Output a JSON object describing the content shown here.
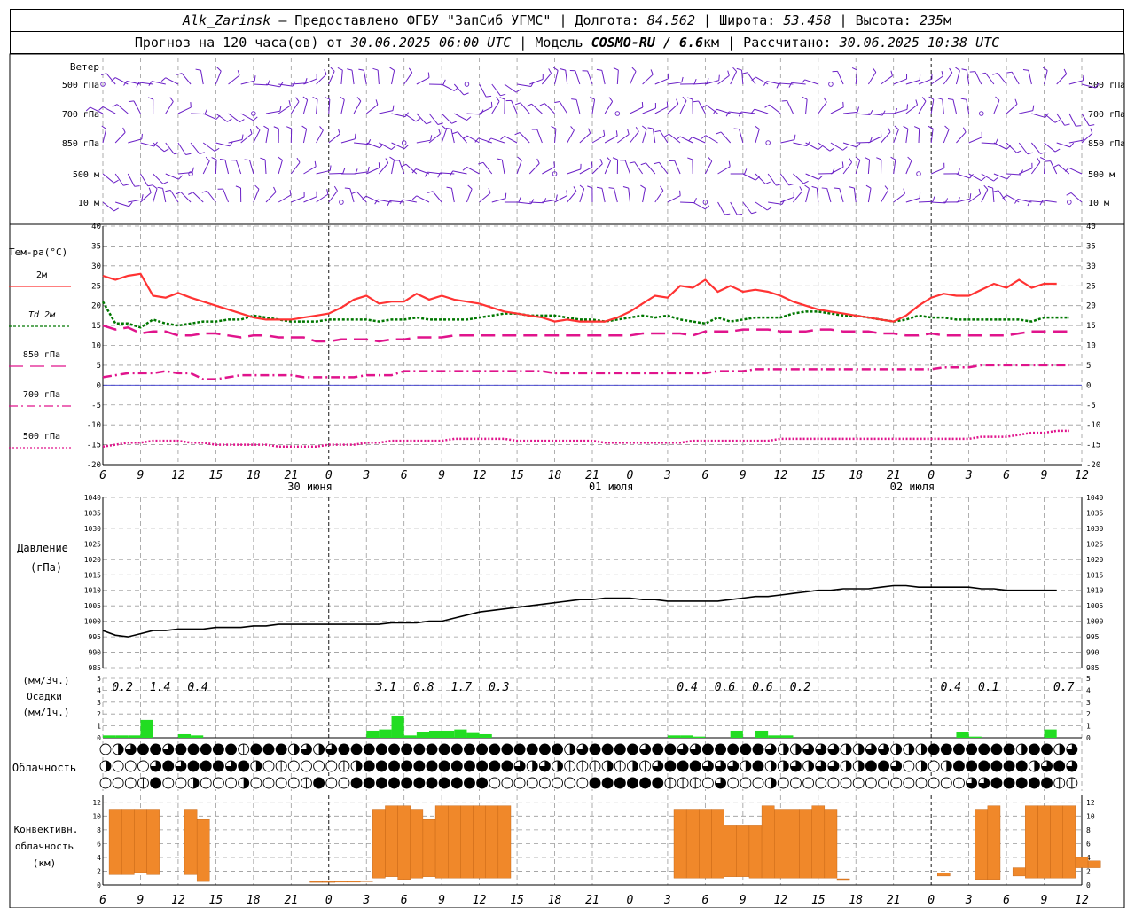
{
  "header": {
    "station": "Alk_Zarinsk",
    "provider": " – Предоставлено ФГБУ \"ЗапСиб УГМС\" | Долгота: ",
    "lon": "84.562",
    "lat_label": " | Широта: ",
    "lat": "53.458",
    "alt_label": " | Высота: ",
    "alt": "235",
    "alt_unit": "м",
    "fc_label": "Прогноз на 120 часа(ов) от ",
    "fc_time": "30.06.2025 06:00 UTC",
    "model_label": " | Модель ",
    "model": "COSMO-RU / 6.6",
    "model_unit": "км",
    "calc_label": " | Рассчитано: ",
    "calc_time": "30.06.2025 10:38 UTC"
  },
  "labels": {
    "wind_title": "Ветер",
    "wind_levels": [
      "500 гПа",
      "700 гПа",
      "850 гПа",
      "500 м",
      "10 м"
    ],
    "temp_title": "Тем-ра(°C)",
    "legend": [
      {
        "label": "2м",
        "color": "#ff3333",
        "dash": ""
      },
      {
        "label": "Td 2м",
        "color": "#007700",
        "dash": "3,2"
      },
      {
        "label": "850 гПа",
        "color": "#e0148c",
        "dash": "16,8"
      },
      {
        "label": "700 гПа",
        "color": "#e0148c",
        "dash": "10,4,2,4"
      },
      {
        "label": "500 гПа",
        "color": "#e0148c",
        "dash": "2,2"
      }
    ],
    "pressure_title": "Давление",
    "pressure_unit": "(гПа)",
    "precip_unit3": "(мм/3ч.)",
    "precip_title": "Осадки",
    "precip_unit1": "(мм/1ч.)",
    "cloud_title": "Облачность",
    "conv_title1": "Конвективн.",
    "conv_title2": "облачность",
    "conv_unit": "(км)",
    "dates": [
      "30 июня",
      "01 июля",
      "02 июля"
    ]
  },
  "chart_data": {
    "type": "meteogram",
    "x_ticks": [
      "6",
      "9",
      "12",
      "15",
      "18",
      "21",
      "0",
      "3",
      "6",
      "9",
      "12",
      "15",
      "18",
      "21",
      "0",
      "3",
      "6",
      "9",
      "12",
      "15",
      "18",
      "21",
      "0",
      "3",
      "6",
      "9",
      "12"
    ],
    "temperature": {
      "ylim": [
        -20,
        40
      ],
      "ticks": [
        "40",
        "35",
        "30",
        "25",
        "20",
        "15",
        "10",
        "5",
        "0",
        "-5",
        "-10",
        "-15",
        "-20"
      ],
      "t2m": [
        27.5,
        26.5,
        27.5,
        28,
        22.5,
        22,
        23.2,
        22,
        21,
        20,
        19,
        18,
        17,
        16.5,
        16.5,
        16.5,
        17,
        17.5,
        18,
        19.5,
        21.5,
        22.5,
        20.5,
        21,
        21,
        23,
        21.5,
        22.5,
        21.5,
        21,
        20.5,
        19.5,
        18.5,
        18,
        17.5,
        17,
        16,
        16.5,
        16,
        16,
        16,
        17,
        18.5,
        20.5,
        22.5,
        22,
        25,
        24.5,
        26.5,
        23.5,
        25,
        23.5,
        24,
        23.5,
        22.5,
        21,
        20,
        19,
        18.5,
        18,
        17.5,
        17,
        16.5,
        16,
        17.5,
        20,
        22,
        23,
        22.5,
        22.5,
        24,
        25.5,
        24.5,
        26.5,
        24.5,
        25.5,
        25.5
      ],
      "td2m": [
        21,
        15.5,
        15.5,
        14.5,
        16.5,
        15.5,
        15,
        15.5,
        16,
        16,
        16.5,
        16.5,
        17.5,
        17,
        16.5,
        16,
        16,
        16,
        16.5,
        16.5,
        16.5,
        16.5,
        16,
        16.5,
        16.5,
        17,
        16.5,
        16.5,
        16.5,
        16.5,
        17,
        17.5,
        18,
        18,
        17.5,
        17.5,
        17.5,
        17,
        16.5,
        16.5,
        16,
        16.5,
        17,
        17.5,
        17,
        17.5,
        16.5,
        16,
        15.5,
        17,
        16,
        16.5,
        17,
        17,
        17,
        18,
        18.5,
        18.5,
        18,
        17.5,
        17.5,
        17,
        16.5,
        16,
        16.5,
        17.5,
        17,
        17,
        16.5,
        16.5,
        16.5,
        16.5,
        16.5,
        16.5,
        16,
        17,
        17,
        17
      ],
      "t850": [
        15,
        14,
        14.5,
        13,
        13.5,
        13.5,
        12.5,
        12.5,
        13,
        13,
        12.5,
        12,
        12.5,
        12.5,
        12,
        12,
        12,
        11,
        11,
        11.5,
        11.5,
        11.5,
        11,
        11.5,
        11.5,
        12,
        12,
        12,
        12.5,
        12.5,
        12.5,
        12.5,
        12.5,
        12.5,
        12.5,
        12.5,
        12.5,
        12.5,
        12.5,
        12.5,
        12.5,
        12.5,
        12.5,
        13,
        13,
        13,
        13,
        12.5,
        13.5,
        13.5,
        13.5,
        14,
        14,
        14,
        13.5,
        13.5,
        13.5,
        14,
        14,
        13.5,
        13.5,
        13.5,
        13,
        13,
        12.5,
        12.5,
        13,
        12.5,
        12.5,
        12.5,
        12.5,
        12.5,
        12.5,
        13,
        13.5,
        13.5,
        13.5,
        13.5
      ],
      "t700": [
        2,
        2.5,
        3,
        3,
        3,
        3.5,
        3,
        3,
        1.5,
        1.5,
        2,
        2.5,
        2.5,
        2.5,
        2.5,
        2.5,
        2,
        2,
        2,
        2,
        2,
        2.5,
        2.5,
        2.5,
        3.5,
        3.5,
        3.5,
        3.5,
        3.5,
        3.5,
        3.5,
        3.5,
        3.5,
        3.5,
        3.5,
        3.5,
        3,
        3,
        3,
        3,
        3,
        3,
        3,
        3,
        3,
        3,
        3,
        3,
        3,
        3.5,
        3.5,
        3.5,
        4,
        4,
        4,
        4,
        4,
        4,
        4,
        4,
        4,
        4,
        4,
        4,
        4,
        4,
        4,
        4.5,
        4.5,
        4.5,
        5,
        5,
        5,
        5,
        5,
        5,
        5,
        5
      ],
      "t500": [
        -15.5,
        -15,
        -14.5,
        -14.5,
        -14,
        -14,
        -14,
        -14.5,
        -14.5,
        -15,
        -15,
        -15,
        -15,
        -15,
        -15.5,
        -15.5,
        -15.5,
        -15.5,
        -15,
        -15,
        -15,
        -14.5,
        -14.5,
        -14,
        -14,
        -14,
        -14,
        -14,
        -13.5,
        -13.5,
        -13.5,
        -13.5,
        -13.5,
        -14,
        -14,
        -14,
        -14,
        -14,
        -14,
        -14,
        -14.5,
        -14.5,
        -14.5,
        -14.5,
        -14.5,
        -14.5,
        -14.5,
        -14,
        -14,
        -14,
        -14,
        -14,
        -14,
        -14,
        -13.5,
        -13.5,
        -13.5,
        -13.5,
        -13.5,
        -13.5,
        -13.5,
        -13.5,
        -13.5,
        -13.5,
        -13.5,
        -13.5,
        -13.5,
        -13.5,
        -13.5,
        -13.5,
        -13,
        -13,
        -13,
        -12.5,
        -12,
        -12,
        -11.5,
        -11.5
      ]
    },
    "pressure": {
      "ylim": [
        985,
        1040
      ],
      "ticks": [
        "1040",
        "1035",
        "1030",
        "1025",
        "1020",
        "1015",
        "1010",
        "1005",
        "1000",
        "995",
        "990",
        "985"
      ],
      "values": [
        997,
        995.5,
        995,
        996,
        997,
        997,
        997.5,
        997.5,
        997.5,
        998,
        998,
        998,
        998.5,
        998.5,
        999,
        999,
        999,
        999,
        999,
        999,
        999,
        999,
        999,
        999.5,
        999.5,
        999.5,
        1000,
        1000,
        1001,
        1002,
        1003,
        1003.5,
        1004,
        1004.5,
        1005,
        1005.5,
        1006,
        1006.5,
        1007,
        1007,
        1007.5,
        1007.5,
        1007.5,
        1007,
        1007,
        1006.5,
        1006.5,
        1006.5,
        1006.5,
        1006.5,
        1007,
        1007.5,
        1008,
        1008,
        1008.5,
        1009,
        1009.5,
        1010,
        1010,
        1010.5,
        1010.5,
        1010.5,
        1011,
        1011.5,
        1011.5,
        1011,
        1011,
        1011,
        1011,
        1011,
        1010.5,
        1010.5,
        1010,
        1010,
        1010,
        1010,
        1010
      ]
    },
    "precipitation": {
      "ylim": [
        0,
        5
      ],
      "ticks": [
        "5",
        "4",
        "3",
        "2",
        "1",
        "0"
      ],
      "sums_3h": [
        {
          "t": 1,
          "label": "0.2"
        },
        {
          "t": 4,
          "label": "1.4"
        },
        {
          "t": 7,
          "label": "0.4"
        },
        {
          "t": 22,
          "label": "3.1"
        },
        {
          "t": 25,
          "label": "0.8"
        },
        {
          "t": 28,
          "label": "1.7"
        },
        {
          "t": 31,
          "label": "0.3"
        },
        {
          "t": 46,
          "label": "0.4"
        },
        {
          "t": 49,
          "label": "0.6"
        },
        {
          "t": 52,
          "label": "0.6"
        },
        {
          "t": 55,
          "label": "0.2"
        },
        {
          "t": 67,
          "label": "0.4"
        },
        {
          "t": 70,
          "label": "0.1"
        },
        {
          "t": 76,
          "label": "0.7"
        }
      ],
      "hourly": [
        [
          0,
          0.2
        ],
        [
          1,
          0.2
        ],
        [
          2,
          0.2
        ],
        [
          3,
          1.5
        ],
        [
          6,
          0.3
        ],
        [
          7,
          0.2
        ],
        [
          21,
          0.6
        ],
        [
          22,
          0.7
        ],
        [
          23,
          1.8
        ],
        [
          24,
          0.2
        ],
        [
          25,
          0.5
        ],
        [
          26,
          0.6
        ],
        [
          27,
          0.6
        ],
        [
          28,
          0.7
        ],
        [
          29,
          0.4
        ],
        [
          30,
          0.3
        ],
        [
          45,
          0.2
        ],
        [
          46,
          0.2
        ],
        [
          47,
          0.1
        ],
        [
          50,
          0.6
        ],
        [
          52,
          0.6
        ],
        [
          53,
          0.2
        ],
        [
          54,
          0.2
        ],
        [
          68,
          0.5
        ],
        [
          69,
          0.1
        ],
        [
          75,
          0.7
        ]
      ]
    },
    "cloudiness": {
      "rows": [
        "high",
        "middle",
        "low"
      ],
      "note": "octa fraction per hour, 0..1",
      "high": [
        0,
        0.5,
        0.75,
        1,
        1,
        0.75,
        1,
        1,
        1,
        1,
        1,
        0.25,
        1,
        1,
        1,
        0.5,
        0.75,
        0.5,
        0.75,
        1,
        1,
        1,
        1,
        1,
        1,
        1,
        1,
        1,
        1,
        1,
        1,
        1,
        1,
        1,
        1,
        1,
        1,
        0.5,
        0.75,
        1,
        1,
        1,
        1,
        0.75,
        1,
        1,
        0.75,
        0.75,
        1,
        1,
        1,
        1,
        1,
        0.75,
        0.5,
        0.5,
        0.75,
        0.75,
        0.75,
        0.5,
        0.5,
        0.75,
        0.75,
        0.5,
        0.5,
        0.5,
        1,
        1,
        1,
        1,
        1,
        1,
        1,
        0.5,
        1,
        1,
        0.5,
        0.75
      ],
      "middle": [
        0.5,
        0,
        0,
        0,
        0.75,
        1,
        0.75,
        1,
        1,
        1,
        0.75,
        1,
        0.5,
        0,
        0.25,
        0,
        0,
        0,
        0,
        0.25,
        0.5,
        1,
        1,
        1,
        1,
        1,
        1,
        1,
        1,
        1,
        1,
        1,
        1,
        0.75,
        0.5,
        0.75,
        0.5,
        0.25,
        0.25,
        0.25,
        0.5,
        0.25,
        0.5,
        0.25,
        0.75,
        1,
        1,
        1,
        0.75,
        0.75,
        0.75,
        0.5,
        1,
        0.5,
        0.5,
        0.75,
        0.5,
        0.75,
        0.75,
        0.5,
        0.5,
        1,
        1,
        0.75,
        0,
        0.5,
        0,
        0.5,
        1,
        1,
        1,
        1,
        1,
        1,
        0.5,
        0.75,
        1,
        0.75
      ],
      "low": [
        0,
        0,
        0,
        0.25,
        1,
        0,
        0,
        0.5,
        0,
        0,
        0,
        0.5,
        0,
        0,
        0,
        0,
        0.25,
        1,
        0,
        0,
        1,
        1,
        1,
        1,
        1,
        1,
        1,
        1,
        1,
        1,
        1,
        0,
        0,
        0,
        0,
        0,
        0,
        0,
        0,
        1,
        1,
        1,
        1,
        1,
        1,
        0.25,
        0.25,
        0.25,
        0,
        0.75,
        0,
        0,
        0,
        0.5,
        0,
        0,
        0,
        0,
        0,
        0,
        0,
        0,
        0,
        0,
        0,
        0,
        0,
        0,
        0.25,
        0.75,
        0.75,
        1,
        1,
        1,
        1,
        1,
        0.25,
        0.25
      ]
    },
    "convective_cloud": {
      "ylim": [
        0,
        13
      ],
      "ticks": [
        "12",
        "10",
        "8",
        "6",
        "4",
        "2",
        "0"
      ],
      "bars": [
        [
          1,
          1.5,
          11
        ],
        [
          2,
          1.5,
          11
        ],
        [
          3,
          1.8,
          11
        ],
        [
          4,
          1.5,
          11
        ],
        [
          7,
          1.5,
          11
        ],
        [
          8,
          0.5,
          9.5
        ],
        [
          17,
          0.4,
          0.5
        ],
        [
          18,
          0.4,
          0.5
        ],
        [
          19,
          0.4,
          0.6
        ],
        [
          20,
          0.4,
          0.6
        ],
        [
          21,
          0.5,
          0.6
        ],
        [
          22,
          1,
          11
        ],
        [
          23,
          1.2,
          11.5
        ],
        [
          24,
          0.8,
          11.5
        ],
        [
          25,
          1,
          11
        ],
        [
          26,
          1.2,
          9.5
        ],
        [
          27,
          1,
          11.5
        ],
        [
          28,
          1,
          11.5
        ],
        [
          29,
          1,
          11.5
        ],
        [
          30,
          1,
          11.5
        ],
        [
          31,
          1,
          11.5
        ],
        [
          32,
          1,
          11.5
        ],
        [
          46,
          1,
          11
        ],
        [
          47,
          1,
          11
        ],
        [
          48,
          1,
          11
        ],
        [
          49,
          1,
          11
        ],
        [
          50,
          1.2,
          8.7
        ],
        [
          51,
          1.2,
          8.7
        ],
        [
          52,
          1,
          8.7
        ],
        [
          53,
          1,
          11.5
        ],
        [
          54,
          1,
          11
        ],
        [
          55,
          1,
          11
        ],
        [
          56,
          1,
          11
        ],
        [
          57,
          1,
          11.5
        ],
        [
          58,
          1,
          11
        ],
        [
          59,
          1,
          0.9
        ],
        [
          67,
          1.3,
          1.7
        ],
        [
          70,
          0.8,
          11
        ],
        [
          71,
          0.8,
          11.5
        ],
        [
          73,
          1.3,
          2.5
        ],
        [
          74,
          1,
          11.5
        ],
        [
          75,
          1,
          11.5
        ],
        [
          76,
          1,
          11.5
        ],
        [
          77,
          1,
          11.5
        ],
        [
          78,
          2.5,
          4
        ],
        [
          79,
          2.5,
          3.5
        ]
      ]
    }
  }
}
